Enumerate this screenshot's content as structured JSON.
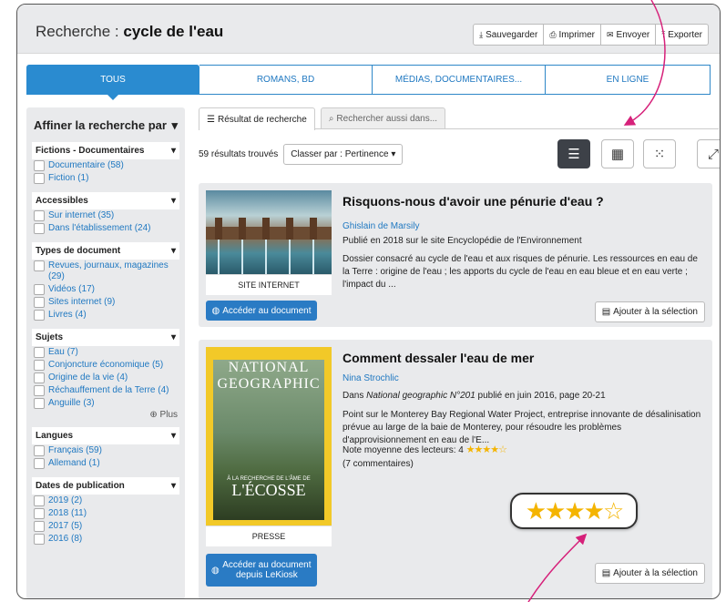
{
  "header": {
    "prefix": "Recherche : ",
    "query": "cycle de l'eau"
  },
  "actions": [
    {
      "icon": "⤓",
      "label": "Sauvegarder"
    },
    {
      "icon": "⎙",
      "label": "Imprimer"
    },
    {
      "icon": "✉",
      "label": "Envoyer"
    },
    {
      "icon": "⤒",
      "label": "Exporter"
    }
  ],
  "category_tabs": [
    "TOUS",
    "ROMANS, BD",
    "MÉDIAS, DOCUMENTAIRES...",
    "EN LIGNE"
  ],
  "sidebar": {
    "title": "Affiner la recherche par",
    "groups": [
      {
        "title": "Fictions - Documentaires",
        "items": [
          "Documentaire (58)",
          "Fiction (1)"
        ]
      },
      {
        "title": "Accessibles",
        "items": [
          "Sur internet (35)",
          "Dans l'établissement (24)"
        ]
      },
      {
        "title": "Types de document",
        "items": [
          "Revues, journaux, magazines (29)",
          "Vidéos (17)",
          "Sites internet (9)",
          "Livres (4)"
        ]
      },
      {
        "title": "Sujets",
        "items": [
          "Eau (7)",
          "Conjoncture économique (5)",
          "Origine de la vie (4)",
          "Réchauffement de la Terre (4)",
          "Anguille (3)"
        ],
        "more": "Plus"
      },
      {
        "title": "Langues",
        "items": [
          "Français (59)",
          "Allemand (1)"
        ]
      },
      {
        "title": "Dates de publication",
        "items": [
          "2019 (2)",
          "2018 (11)",
          "2017 (5)",
          "2016 (8)"
        ]
      }
    ]
  },
  "result_tabs": [
    "Résultat de recherche",
    "Rechercher aussi dans..."
  ],
  "results_count": "59 résultats trouvés",
  "sort_label": "Classer par : Pertinence",
  "results": [
    {
      "type_label": "SITE INTERNET",
      "title": "Risquons-nous d'avoir une pénurie d'eau ?",
      "author": "Ghislain de Marsily",
      "published": "Publié en 2018 sur le site Encyclopédie de l'Environnement",
      "description": "Dossier consacré au cycle de l'eau et aux risques de pénurie. Les ressources en eau de la Terre : origine de l'eau ; les apports du cycle de l'eau en eau bleue et en eau verte ; l'impact du ...",
      "access_button": "Accéder au document",
      "select_button": "Ajouter à la sélection"
    },
    {
      "type_label": "PRESSE",
      "title": "Comment dessaler l'eau de mer",
      "author": "Nina Strochlic",
      "published_prefix": "Dans ",
      "published_source": "National geographic N°201",
      "published_suffix": " publié en juin 2016, page 20-21",
      "description": "Point sur le Monterey Bay Regional Water Project, entreprise innovante de désalinisation prévue au large de la baie de Monterey, pour résoudre les problèmes d'approvisionnement en eau de l'E...",
      "rating_label": "Note moyenne des lecteurs: 4",
      "rating": 4,
      "rating_max": 5,
      "comments": "(7 commentaires)",
      "access_button": "Accéder au document depuis LeKiosk",
      "select_button": "Ajouter à la sélection",
      "cover": {
        "masthead": "NATIONAL GEOGRAPHIC",
        "subtitle": "À LA RECHERCHE DE L'ÂME DE",
        "headline": "L'ÉCOSSE"
      }
    }
  ],
  "colors": {
    "accent": "#2a8bd0",
    "star": "#f4b400",
    "panel": "#e9eaec"
  }
}
